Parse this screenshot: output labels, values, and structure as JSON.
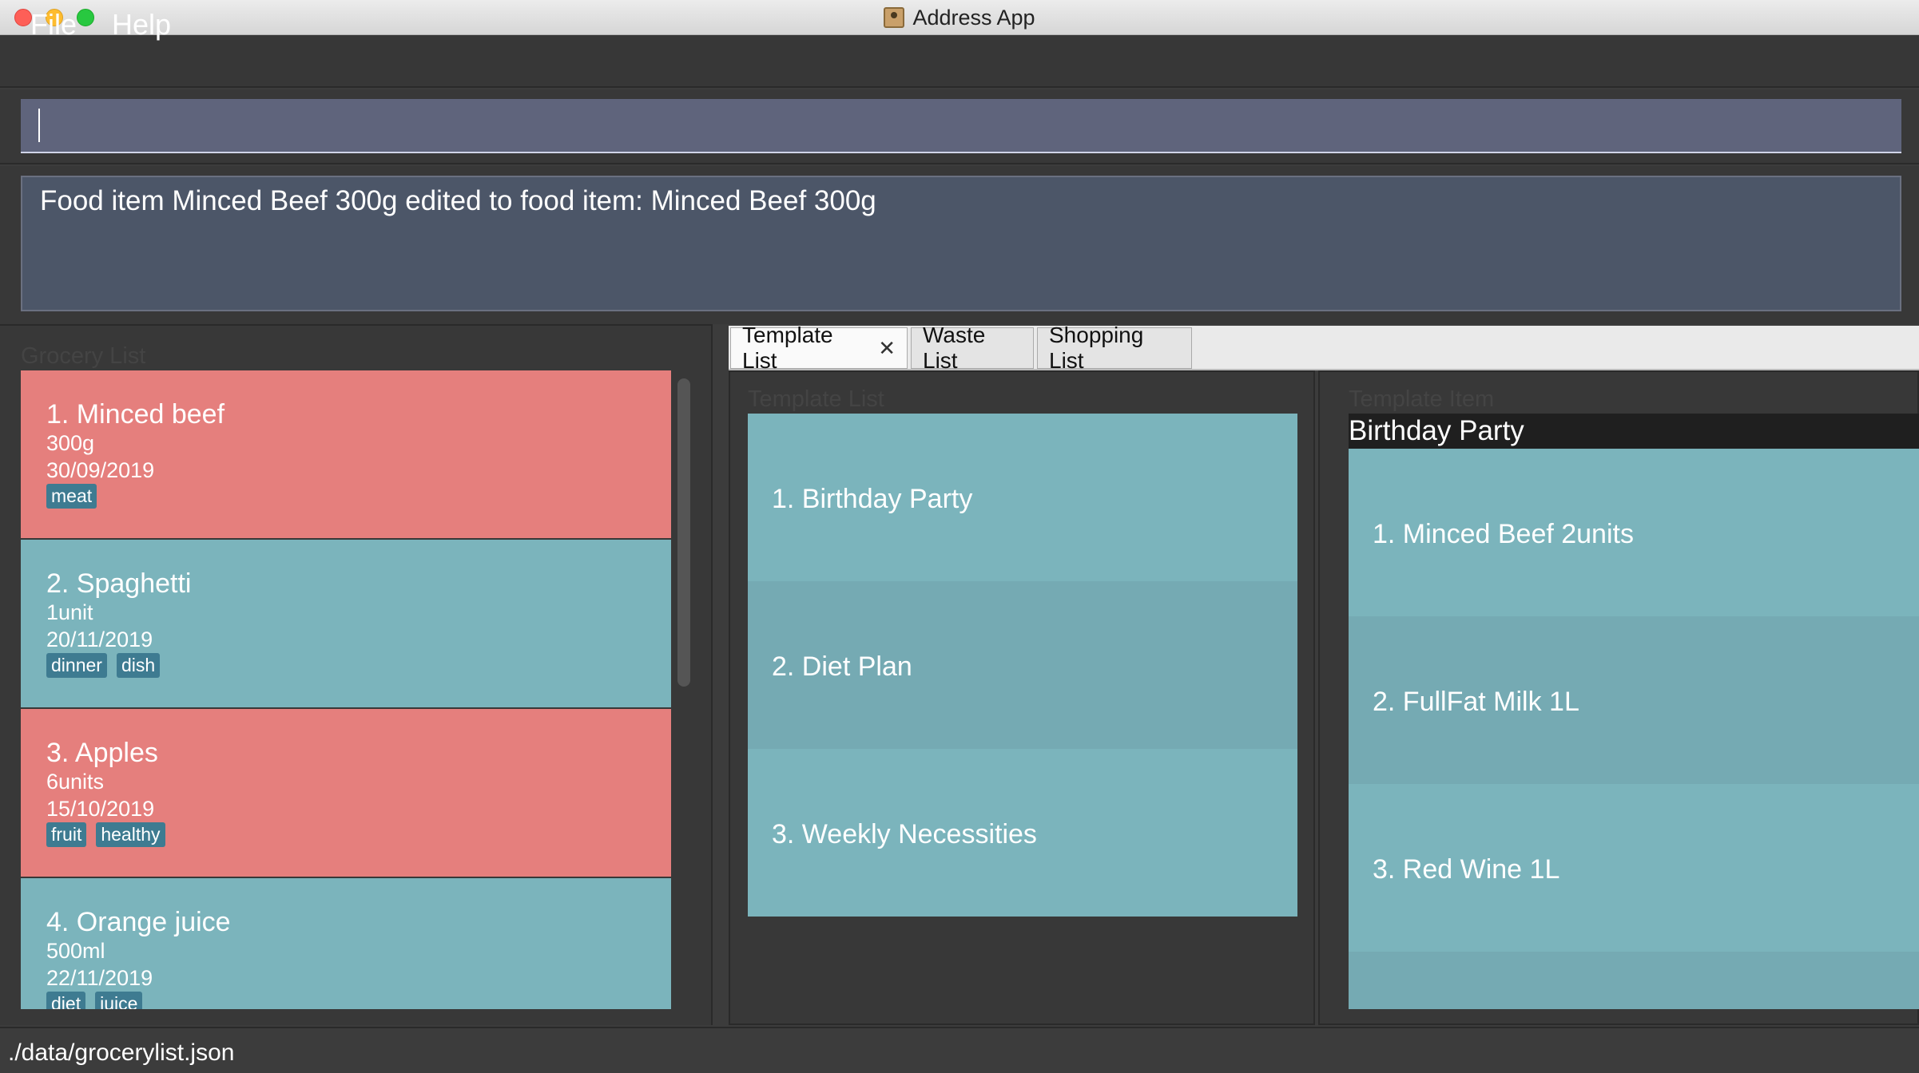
{
  "window": {
    "title": "Address App"
  },
  "menu": {
    "file": "File",
    "help": "Help"
  },
  "command": {
    "value": ""
  },
  "result": {
    "text": "Food item Minced Beef 300g edited to food item: Minced Beef 300g"
  },
  "grocery": {
    "title": "Grocery List",
    "items": [
      {
        "name": "1.  Minced beef",
        "amount": "300g",
        "date": "30/09/2019",
        "tags": [
          "meat"
        ],
        "color": "#e57f7d"
      },
      {
        "name": "2.  Spaghetti",
        "amount": "1unit",
        "date": "20/11/2019",
        "tags": [
          "dinner",
          "dish"
        ],
        "color": "#7bb4bc"
      },
      {
        "name": "3.  Apples",
        "amount": "6units",
        "date": "15/10/2019",
        "tags": [
          "fruit",
          "healthy"
        ],
        "color": "#e57f7d"
      },
      {
        "name": "4.  Orange juice",
        "amount": "500ml",
        "date": "22/11/2019",
        "tags": [
          "diet",
          "juice"
        ],
        "color": "#7bb4bc"
      }
    ]
  },
  "tabs": [
    {
      "label": "Template List",
      "active": true,
      "closable": true
    },
    {
      "label": "Waste List",
      "active": false
    },
    {
      "label": "Shopping List",
      "active": false
    }
  ],
  "template_list": {
    "title": "Template List",
    "items": [
      "1.  Birthday Party",
      "2.  Diet Plan",
      "3.  Weekly Necessities"
    ]
  },
  "template_item": {
    "title": "Template Item",
    "selected": "Birthday Party",
    "items": [
      "1.  Minced Beef 2units",
      "2.  FullFat Milk 1L",
      "3.  Red Wine 1L"
    ]
  },
  "status": {
    "path": "./data/grocerylist.json"
  },
  "colors": {
    "expired": "#e57f7d",
    "fresh": "#7bb4bc",
    "tag": "#3e7b91"
  }
}
